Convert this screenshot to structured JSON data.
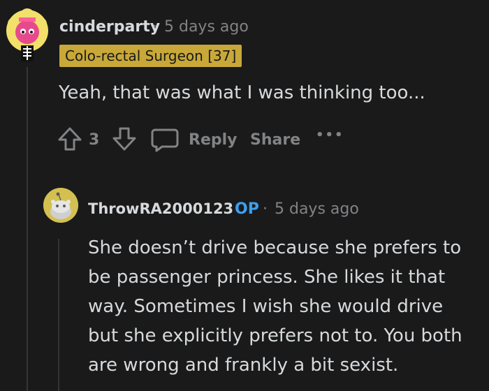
{
  "comment1": {
    "username": "cinderparty",
    "time": "5 days ago",
    "separator": "·",
    "flair": "Colo-rectal Surgeon [37]",
    "body": "Yeah, that was what I was thinking too...",
    "vote_count": "3",
    "reply_label": "Reply",
    "share_label": "Share",
    "more_label": "•••"
  },
  "comment2": {
    "username": "ThrowRA2000123",
    "op_badge": "OP",
    "separator": "·",
    "time": "5 days ago",
    "body_lines": [
      "She doesn’t drive because she prefers to",
      "be passenger princess. She likes it that",
      "way. Sometimes I wish she would drive",
      "but she explicitly prefers not to. You both",
      "are wrong and frankly a bit sexist."
    ]
  },
  "colors": {
    "background": "#1a1a1b",
    "text": "#d7dadc",
    "muted": "#818384",
    "flair_bg": "#c8a838",
    "op_blue": "#3c9ff0"
  },
  "icons": {
    "upvote": "upvote-arrow-icon",
    "downvote": "downvote-arrow-icon",
    "comment": "comment-bubble-icon",
    "more": "more-options-icon"
  }
}
